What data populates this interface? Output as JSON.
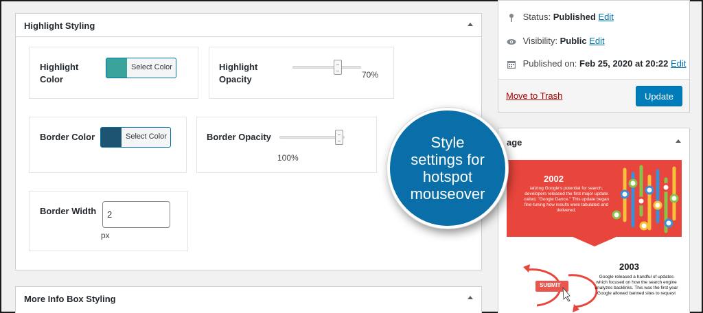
{
  "highlight_panel": {
    "title": "Highlight Styling",
    "highlight_color": {
      "label": "Highlight Color",
      "button": "Select Color",
      "swatch": "#3aa39b"
    },
    "highlight_opacity": {
      "label": "Highlight Opacity",
      "value_text": "70%",
      "value": 0.7
    },
    "border_color": {
      "label": "Border Color",
      "button": "Select Color",
      "swatch": "#1d5471"
    },
    "border_opacity": {
      "label": "Border Opacity",
      "value_text": "100%",
      "value": 1.0
    },
    "border_width": {
      "label": "Border Width",
      "value": "2",
      "unit": "px"
    }
  },
  "more_info_panel": {
    "title": "More Info Box Styling"
  },
  "publish": {
    "status_label": "Status:",
    "status_value": "Published",
    "visibility_label": "Visibility:",
    "visibility_value": "Public",
    "published_label": "Published on:",
    "published_value": "Feb 25, 2020 at 20:22",
    "edit": "Edit",
    "trash": "Move to Trash",
    "update": "Update"
  },
  "image_panel": {
    "title": "age"
  },
  "infographic": {
    "year1": "2002",
    "text1": "ializing Google's potential for search, developers released the first major update called, \"Google Dance.\" This update began fine-tuning how results were tabulated and delivered.",
    "year2": "2003",
    "text2": "Google released a handful of updates which focused on how the search engine analyzes backlinks. This was the first year Google allowed banned sites to request",
    "submit": "SUBMIT"
  },
  "callout": "Style settings for hotspot mouseover",
  "colors": {
    "accent": "#0073aa",
    "primary_button": "#007cba",
    "callout": "#0a6fa8",
    "infographic_red": "#e8453c"
  }
}
